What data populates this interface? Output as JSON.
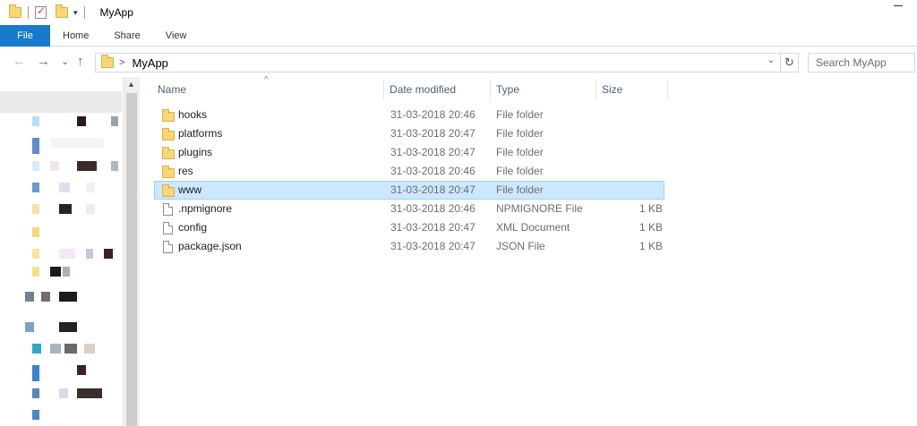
{
  "window": {
    "title": "MyApp"
  },
  "quick_access": {
    "icons": [
      "folder-icon",
      "properties-icon",
      "new-folder-icon"
    ],
    "dropdown": "▾"
  },
  "ribbon": {
    "tabs": [
      "File",
      "Home",
      "Share",
      "View"
    ]
  },
  "address": {
    "back": "←",
    "forward": "→",
    "recent": "⌄",
    "up": "↑",
    "separator": ">",
    "crumb": "MyApp",
    "dropdown": "⌄",
    "refresh": "↻"
  },
  "search": {
    "placeholder": "Search MyApp"
  },
  "columns": {
    "name": "Name",
    "date": "Date modified",
    "type": "Type",
    "size": "Size",
    "sort_indicator": "^"
  },
  "files": [
    {
      "name": "hooks",
      "date": "31-03-2018 20:46",
      "type": "File folder",
      "size": "",
      "icon": "folder-icon"
    },
    {
      "name": "platforms",
      "date": "31-03-2018 20:47",
      "type": "File folder",
      "size": "",
      "icon": "folder-icon"
    },
    {
      "name": "plugins",
      "date": "31-03-2018 20:47",
      "type": "File folder",
      "size": "",
      "icon": "folder-icon"
    },
    {
      "name": "res",
      "date": "31-03-2018 20:46",
      "type": "File folder",
      "size": "",
      "icon": "folder-icon"
    },
    {
      "name": "www",
      "date": "31-03-2018 20:47",
      "type": "File folder",
      "size": "",
      "icon": "folder-icon",
      "selected": true
    },
    {
      "name": ".npmignore",
      "date": "31-03-2018 20:46",
      "type": "NPMIGNORE File",
      "size": "1 KB",
      "icon": "file-icon"
    },
    {
      "name": "config",
      "date": "31-03-2018 20:47",
      "type": "XML Document",
      "size": "1 KB",
      "icon": "file-icon"
    },
    {
      "name": "package.json",
      "date": "31-03-2018 20:47",
      "type": "JSON File",
      "size": "1 KB",
      "icon": "file-icon"
    }
  ],
  "colors": {
    "accent": "#1979ca",
    "selection": "#cce8ff",
    "folder": "#f8d775",
    "header_text": "#4c607a"
  }
}
